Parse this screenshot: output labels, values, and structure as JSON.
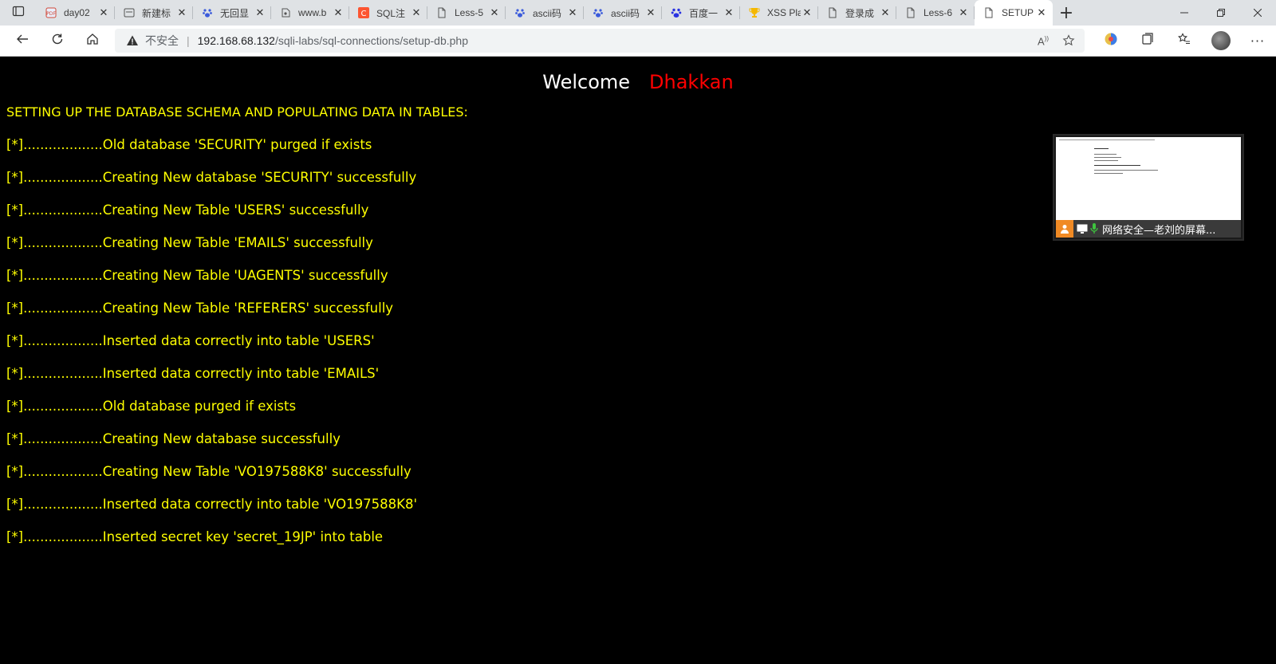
{
  "browser": {
    "tabs": [
      {
        "title": "day02",
        "icon": "pdf-icon"
      },
      {
        "title": "新建标",
        "icon": "page-icon"
      },
      {
        "title": "无回显",
        "icon": "paw-icon"
      },
      {
        "title": "www.b",
        "icon": "share-icon"
      },
      {
        "title": "SQL注",
        "icon": "csdn-icon"
      },
      {
        "title": "Less-5",
        "icon": "document-icon"
      },
      {
        "title": "ascii码",
        "icon": "paw-icon"
      },
      {
        "title": "ascii码",
        "icon": "paw-icon"
      },
      {
        "title": "百度一",
        "icon": "baidu-icon"
      },
      {
        "title": "XSS Pla",
        "icon": "trophy-icon"
      },
      {
        "title": "登录成",
        "icon": "document-icon"
      },
      {
        "title": "Less-6",
        "icon": "document-icon"
      },
      {
        "title": "SETUP",
        "icon": "document-icon",
        "active": true
      }
    ],
    "address": {
      "insecure_label": "不安全",
      "host": "192.168.68.132",
      "path": "/sqli-labs/sql-connections/setup-db.php"
    }
  },
  "page": {
    "welcome": "Welcome",
    "name": "Dhakkan",
    "subtitle": "SETTING UP THE DATABASE SCHEMA AND POPULATING DATA IN TABLES:",
    "log": [
      "[*]...................Old database 'SECURITY' purged if exists",
      "[*]...................Creating New database 'SECURITY' successfully",
      "[*]...................Creating New Table 'USERS' successfully",
      "[*]...................Creating New Table 'EMAILS' successfully",
      "[*]...................Creating New Table 'UAGENTS' successfully",
      "[*]...................Creating New Table 'REFERERS' successfully",
      "[*]...................Inserted data correctly into table 'USERS'",
      "[*]...................Inserted data correctly into table 'EMAILS'",
      "[*]...................Old database purged if exists",
      "[*]...................Creating New database successfully",
      "[*]...................Creating New Table 'VO197588K8' successfully",
      "[*]...................Inserted data correctly into table 'VO197588K8'",
      "[*]...................Inserted secret key 'secret_19JP' into table"
    ]
  },
  "share_overlay": {
    "label": "网络安全—老刘的屏幕..."
  },
  "colors": {
    "text_yellow": "#ffff00",
    "name_red": "#ff0000",
    "background": "#000000"
  }
}
